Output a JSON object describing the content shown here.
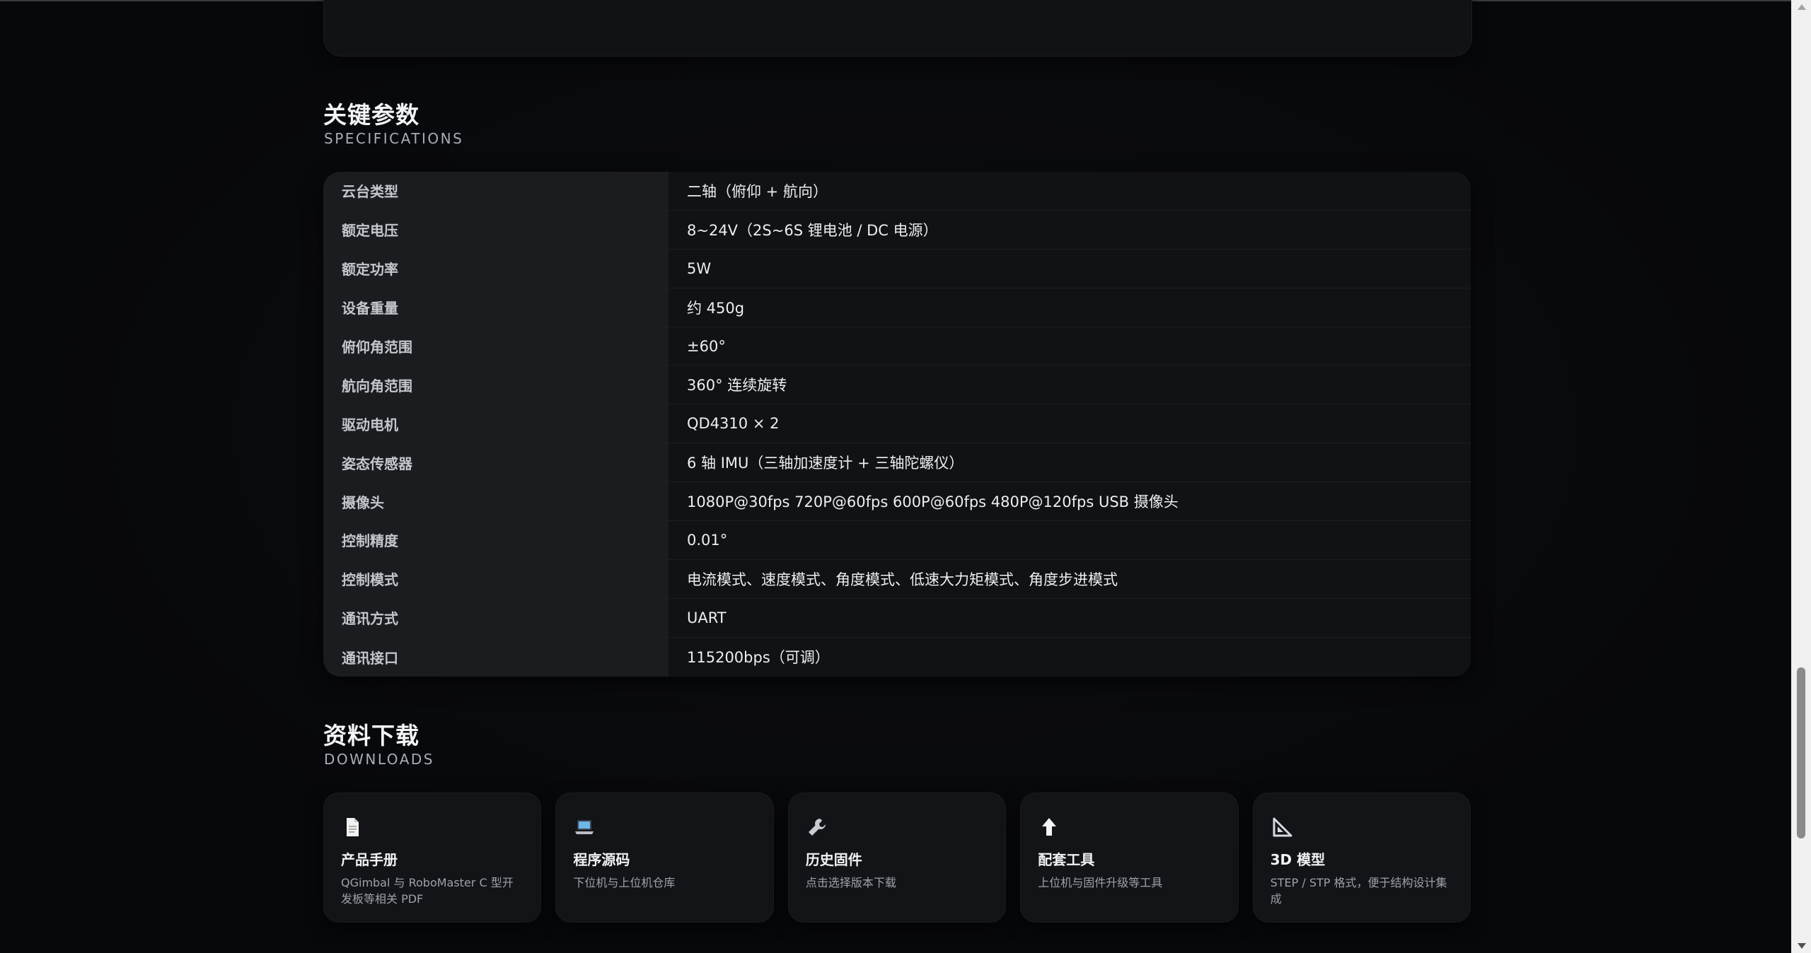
{
  "specs_section": {
    "title": "关键参数",
    "subtitle": "SPECIFICATIONS",
    "rows": [
      {
        "key": "云台类型",
        "value": "二轴（俯仰 + 航向）"
      },
      {
        "key": "额定电压",
        "value": "8~24V（2S~6S 锂电池 / DC 电源）"
      },
      {
        "key": "额定功率",
        "value": "5W"
      },
      {
        "key": "设备重量",
        "value": "约 450g"
      },
      {
        "key": "俯仰角范围",
        "value": "±60°"
      },
      {
        "key": "航向角范围",
        "value": "360° 连续旋转"
      },
      {
        "key": "驱动电机",
        "value": "QD4310 × 2"
      },
      {
        "key": "姿态传感器",
        "value": "6 轴 IMU（三轴加速度计 + 三轴陀螺仪）"
      },
      {
        "key": "摄像头",
        "value": "1080P@30fps 720P@60fps 600P@60fps 480P@120fps USB 摄像头"
      },
      {
        "key": "控制精度",
        "value": "0.01°"
      },
      {
        "key": "控制模式",
        "value": "电流模式、速度模式、角度模式、低速大力矩模式、角度步进模式"
      },
      {
        "key": "通讯方式",
        "value": "UART"
      },
      {
        "key": "通讯接口",
        "value": "115200bps（可调）"
      }
    ]
  },
  "downloads_section": {
    "title": "资料下载",
    "subtitle": "DOWNLOADS",
    "cards": [
      {
        "icon": "document-icon",
        "title": "产品手册",
        "desc": "QGimbal 与 RoboMaster C 型开发板等相关 PDF"
      },
      {
        "icon": "laptop-icon",
        "title": "程序源码",
        "desc": "下位机与上位机仓库"
      },
      {
        "icon": "wrench-icon",
        "title": "历史固件",
        "desc": "点击选择版本下载"
      },
      {
        "icon": "upload-arrow-icon",
        "title": "配套工具",
        "desc": "上位机与固件升级等工具"
      },
      {
        "icon": "triangle-ruler-icon",
        "title": "3D 模型",
        "desc": "STEP / STP 格式，便于结构设计集成"
      }
    ]
  }
}
